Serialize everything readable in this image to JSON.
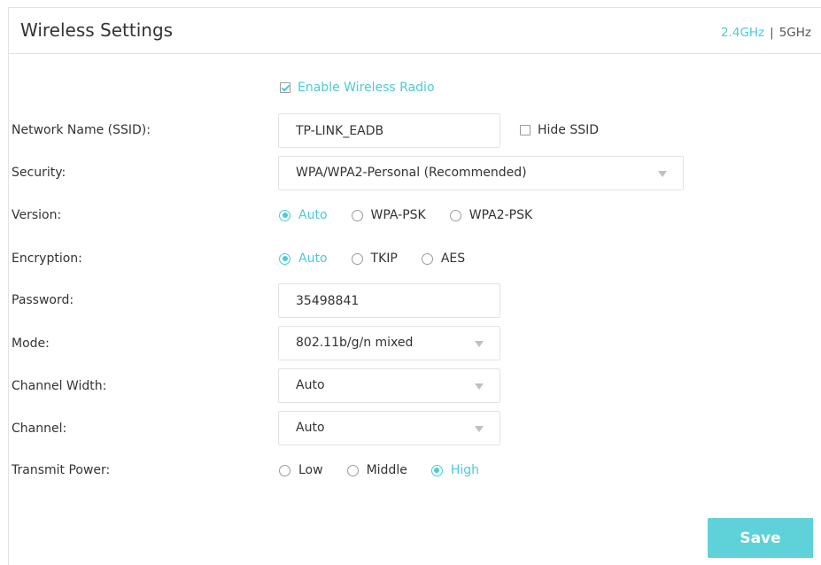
{
  "header": {
    "title": "Wireless Settings",
    "band_24": "2.4GHz",
    "band_sep": "|",
    "band_5": "5GHz"
  },
  "enable_radio": {
    "label": "Enable Wireless Radio",
    "checked": true
  },
  "ssid": {
    "label": "Network Name (SSID):",
    "value": "TP-LINK_EADB",
    "hide_label": "Hide SSID",
    "hide_checked": false
  },
  "security": {
    "label": "Security:",
    "value": "WPA/WPA2-Personal (Recommended)"
  },
  "version": {
    "label": "Version:",
    "options": [
      "Auto",
      "WPA-PSK",
      "WPA2-PSK"
    ],
    "selected": "Auto"
  },
  "encryption": {
    "label": "Encryption:",
    "options": [
      "Auto",
      "TKIP",
      "AES"
    ],
    "selected": "Auto"
  },
  "password": {
    "label": "Password:",
    "value": "35498841"
  },
  "mode": {
    "label": "Mode:",
    "value": "802.11b/g/n mixed"
  },
  "channel_width": {
    "label": "Channel Width:",
    "value": "Auto"
  },
  "channel": {
    "label": "Channel:",
    "value": "Auto"
  },
  "transmit_power": {
    "label": "Transmit Power:",
    "options": [
      "Low",
      "Middle",
      "High"
    ],
    "selected": "High"
  },
  "save_label": "Save",
  "colors": {
    "accent": "#4acbd6",
    "save_bg": "#5ed1d9",
    "border": "#e2e2e2"
  }
}
